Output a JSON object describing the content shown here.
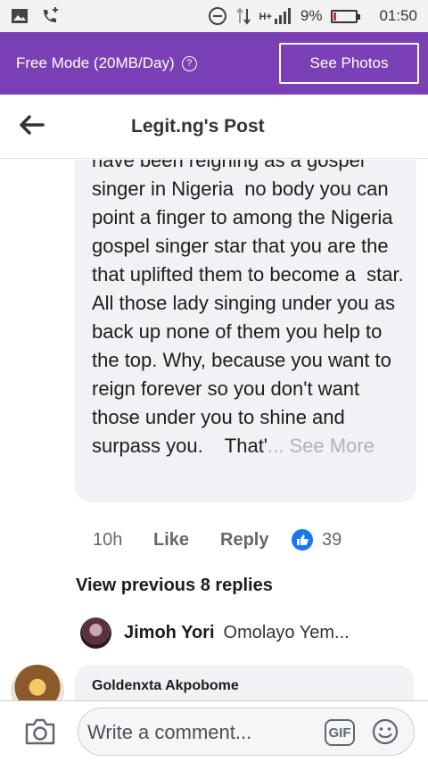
{
  "status_bar": {
    "battery": "9%",
    "time": "01:50",
    "network": "H+"
  },
  "banner": {
    "free_mode_label": "Free Mode (20MB/Day)",
    "info_icon": "info-icon",
    "see_photos_label": "See Photos",
    "background_color": "#7b3fb6"
  },
  "header": {
    "back_icon": "back-arrow-icon",
    "title": "Legit.ng's Post"
  },
  "comment": {
    "text": "have been reigning as a gospel singer in Nigeria  no body you can point a finger to among the Nigeria gospel singer star that you are the that uplifted them to become a  star.  All those lady singing under you as back up none of them you help to the top. Why, because you want to reign forever so you don't want those under you to shine and surpass you.    That'",
    "see_more": "... See More",
    "time": "10h",
    "like_label": "Like",
    "reply_label": "Reply",
    "like_count": "39"
  },
  "replies": {
    "view_previous": "View previous 8 replies",
    "first_reply": {
      "name": "Jimoh Yori",
      "snippet": "Omolayo Yem..."
    }
  },
  "next_comment": {
    "name": "Goldenxta Akpobome"
  },
  "footer": {
    "camera_icon": "camera-icon",
    "comment_placeholder": "Write a comment...",
    "gif_label": "GIF",
    "emoji_icon": "emoji-icon"
  }
}
